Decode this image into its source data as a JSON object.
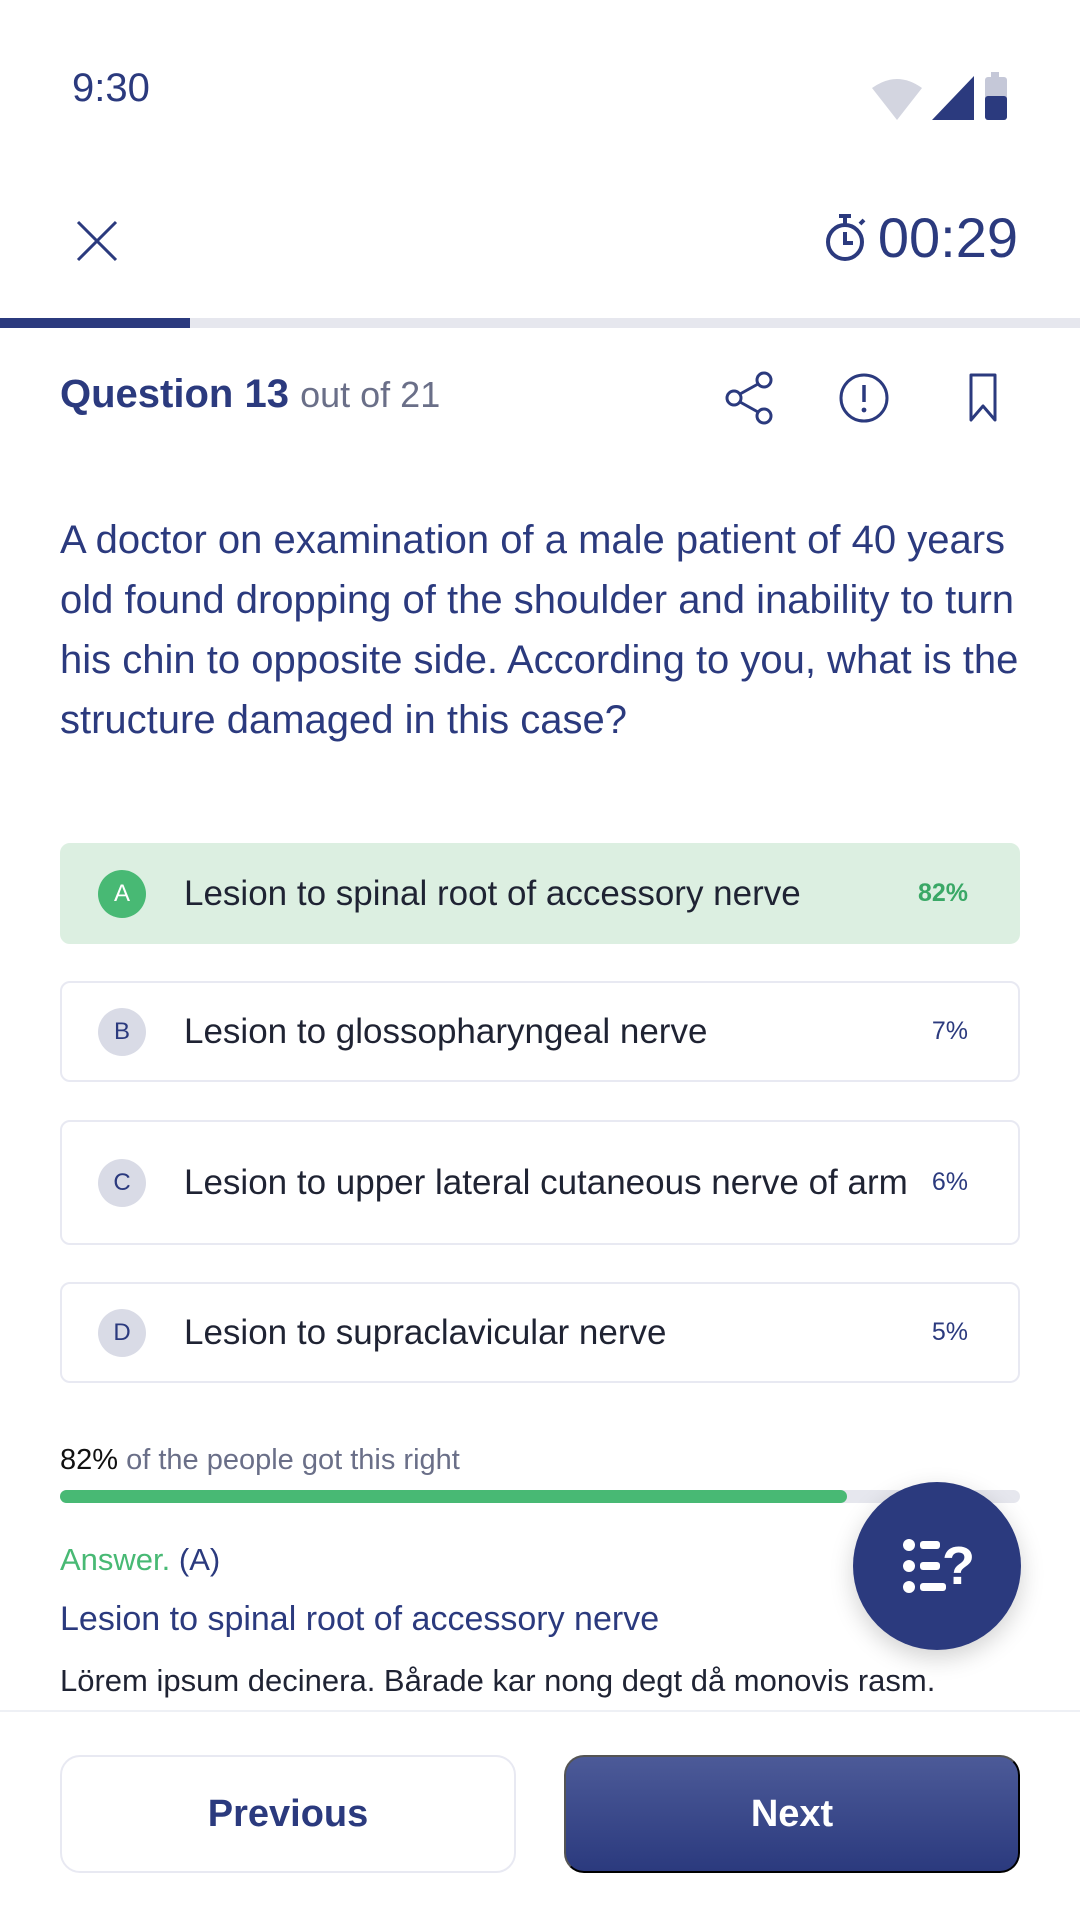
{
  "status_bar": {
    "time": "9:30"
  },
  "header": {
    "timer": "00:29",
    "quiz_progress": 0.176
  },
  "question_header": {
    "label": "Question",
    "number": "13",
    "out_of": "out of 21"
  },
  "question": {
    "text": "A doctor on examination of a male patient of 40 years old found dropping of the shoulder and inability to turn his chin to opposite side. According to you, what is the structure damaged in this case?"
  },
  "options": [
    {
      "letter": "A",
      "text": "Lesion to spinal root of accessory nerve",
      "percent": "82%",
      "correct": true
    },
    {
      "letter": "B",
      "text": "Lesion to glossopharyngeal nerve",
      "percent": "7%"
    },
    {
      "letter": "C",
      "text": "Lesion to upper lateral cutaneous nerve of arm",
      "percent": "6%"
    },
    {
      "letter": "D",
      "text": "Lesion to supraclavicular nerve",
      "percent": "5%"
    }
  ],
  "stats": {
    "percent": "82%",
    "text": "of the people got this right",
    "fill": 0.82
  },
  "answer": {
    "label": "Answer.",
    "letter": "(A)",
    "title": "Lesion to spinal root of accessory nerve",
    "explanation": "Lörem ipsum decinera. Bårade kar nong degt då monovis rasm."
  },
  "footer": {
    "previous": "Previous",
    "next": "Next"
  },
  "colors": {
    "primary": "#2b3a7e",
    "correct": "#48b974",
    "correct_bg": "#dcefe1"
  }
}
